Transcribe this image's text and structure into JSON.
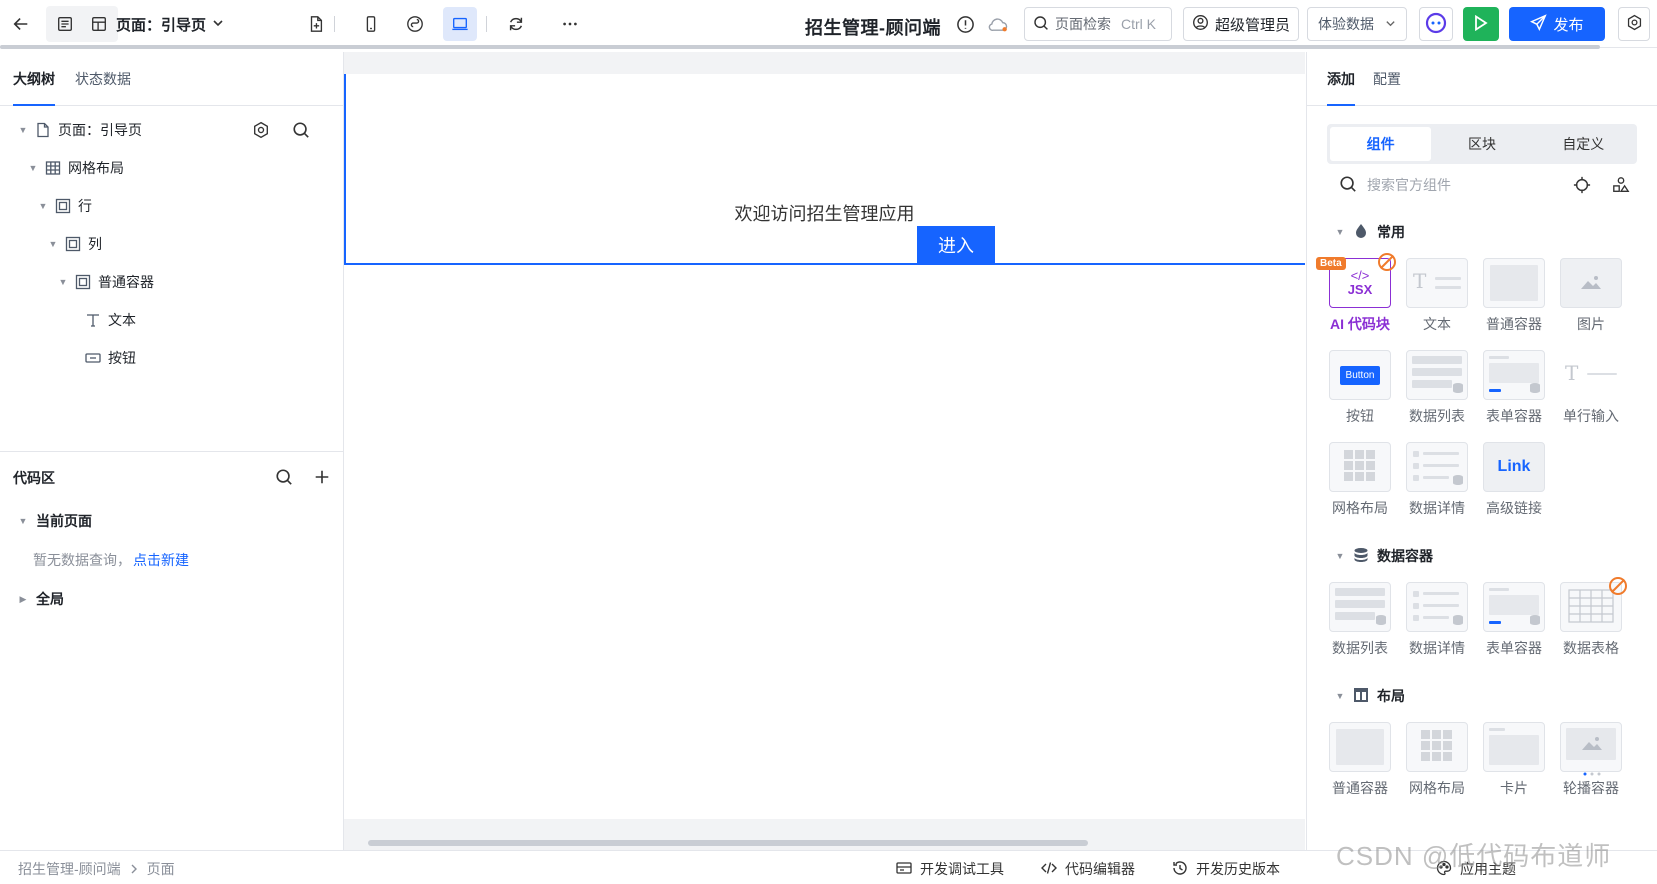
{
  "topbar": {
    "page_label": "页面：引导页",
    "app_title": "招生管理-顾问端",
    "search_label": "页面检索",
    "search_shortcut": "Ctrl K",
    "user_role": "超级管理员",
    "data_mode": "体验数据",
    "publish_label": "发布",
    "colors": {
      "primary": "#1664ff",
      "run": "#1fb35a"
    }
  },
  "left": {
    "tabs": [
      "大纲树",
      "状态数据"
    ],
    "tree": [
      {
        "label": "页面：引导页",
        "icon": "file-icon"
      },
      {
        "label": "网格布局",
        "icon": "grid-icon"
      },
      {
        "label": "行",
        "icon": "row-icon"
      },
      {
        "label": "列",
        "icon": "column-icon"
      },
      {
        "label": "普通容器",
        "icon": "container-icon"
      },
      {
        "label": "文本",
        "icon": "text-icon"
      },
      {
        "label": "按钮",
        "icon": "button-icon"
      }
    ],
    "code": {
      "title": "代码区",
      "current_page": "当前页面",
      "empty_text": "暂无数据查询，",
      "create_link": "点击新建",
      "global": "全局"
    }
  },
  "canvas": {
    "welcome_text": "欢迎访问招生管理应用",
    "enter_label": "进入"
  },
  "right": {
    "tabs": [
      "添加",
      "配置"
    ],
    "segments": [
      "组件",
      "区块",
      "自定义"
    ],
    "search_placeholder": "搜索官方组件",
    "categories": {
      "common": "常用",
      "data": "数据容器",
      "layout": "布局"
    },
    "common_items": [
      "AI 代码块",
      "文本",
      "普通容器",
      "图片",
      "按钮",
      "数据列表",
      "表单容器",
      "单行输入",
      "网格布局",
      "数据详情",
      "高级链接"
    ],
    "data_items": [
      "数据列表",
      "数据详情",
      "表单容器",
      "数据表格"
    ],
    "layout_items": [
      "普通容器",
      "网格布局",
      "卡片",
      "轮播容器"
    ],
    "thumb_text": {
      "beta": "Beta",
      "jsx": "JSX",
      "button": "Button",
      "link": "Link"
    }
  },
  "footer": {
    "crumbs": [
      "招生管理-顾问端",
      "页面"
    ],
    "debug": "开发调试工具",
    "code_editor": "代码编辑器",
    "history": "开发历史版本",
    "theme": "应用主题"
  },
  "watermark": "CSDN @低代码布道师"
}
